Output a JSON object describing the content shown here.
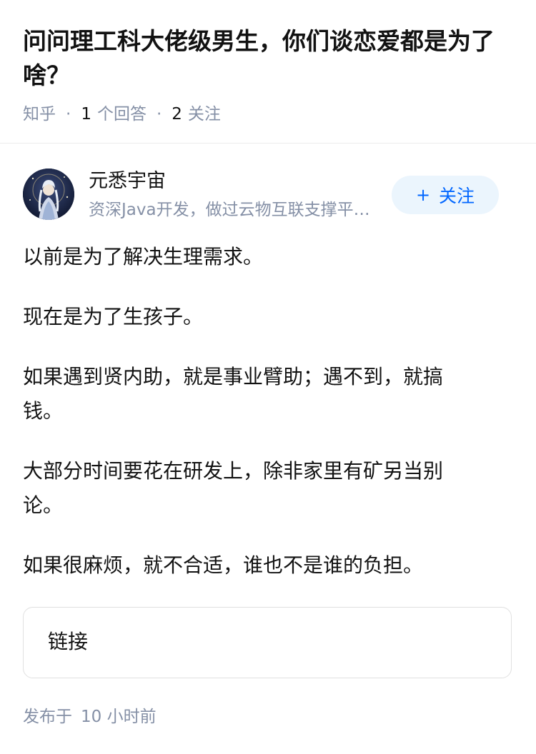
{
  "question": {
    "title": "问问理工科大佬级男生，你们谈恋爱都是为了啥？",
    "source": "知乎",
    "answer_count": "1",
    "answer_label": "个回答",
    "follower_count": "2",
    "follower_label": "关注"
  },
  "author": {
    "name": "元悉宇宙",
    "bio": "资深Java开发，做过云物互联支撑平台的研发",
    "avatar_icon": "avatar-illustration",
    "follow_label": "关注",
    "follow_icon": "plus-icon"
  },
  "answer": {
    "paragraphs": [
      "以前是为了解决生理需求。",
      "现在是为了生孩子。",
      "如果遇到贤内助，就是事业臂助；遇不到，就搞钱。",
      "大部分时间要花在研发上，除非家里有矿另当别论。",
      "如果很麻烦，就不合适，谁也不是谁的负担。"
    ],
    "link_label": "链接"
  },
  "footer": {
    "published_label": "发布于",
    "published_time": "10 小时前"
  },
  "colors": {
    "accent": "#0066ff",
    "meta_gray": "#8590a6",
    "follow_bg": "#ebf5fd",
    "text": "#121212"
  }
}
